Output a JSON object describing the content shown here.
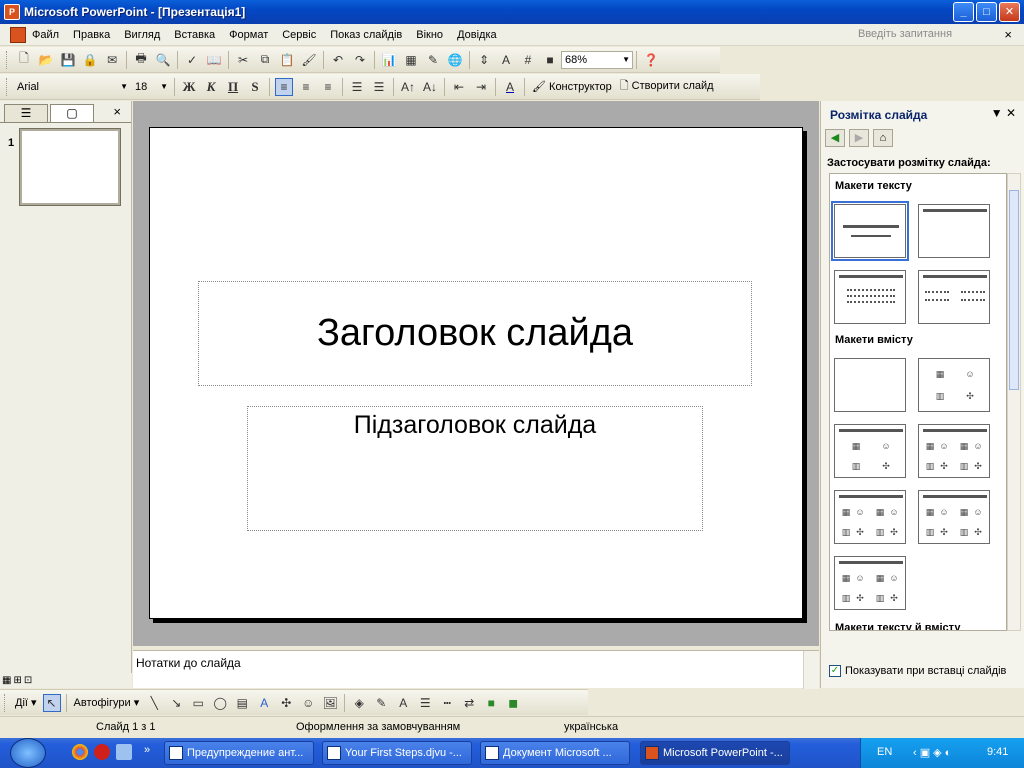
{
  "window": {
    "title": "Microsoft PowerPoint - [Презентація1]",
    "minimize": "_",
    "maximize": "□",
    "close": "✕"
  },
  "menu": {
    "items": [
      "Файл",
      "Правка",
      "Вигляд",
      "Вставка",
      "Формат",
      "Сервіс",
      "Показ слайдів",
      "Вікно",
      "Довідка"
    ],
    "ask_placeholder": "Введіть запитання",
    "close": "×"
  },
  "toolbar_standard": {
    "zoom": "68%"
  },
  "toolbar_format": {
    "font": "Arial",
    "size": "18",
    "bold": "Ж",
    "italic": "К",
    "underline": "П",
    "shadow": "S",
    "designer": "Конструктор",
    "new_slide": "Створити слайд"
  },
  "left_pane": {
    "slide_number": "1",
    "close": "×"
  },
  "slide": {
    "title_placeholder": "Заголовок слайда",
    "subtitle_placeholder": "Підзаголовок слайда"
  },
  "notes": {
    "placeholder": "Нотатки до слайда"
  },
  "task_pane": {
    "title": "Розмітка слайда",
    "apply_label": "Застосувати розмітку слайда:",
    "section_text": "Макети тексту",
    "section_content": "Макети вмісту",
    "section_text_content": "Макети тексту й вмісту",
    "show_on_insert": "Показувати при вставці слайдів"
  },
  "draw_toolbar": {
    "actions": "Дії",
    "autoshapes": "Автофігури"
  },
  "status_bar": {
    "slide": "Слайд 1 з 1",
    "design": "Оформлення за замовчуванням",
    "language": "українська"
  },
  "taskbar": {
    "buttons": [
      "Предупреждение ант...",
      "Your First Steps.djvu -...",
      "Документ Microsoft ...",
      "Microsoft PowerPoint -..."
    ],
    "lang": "EN",
    "time": "9:41"
  }
}
